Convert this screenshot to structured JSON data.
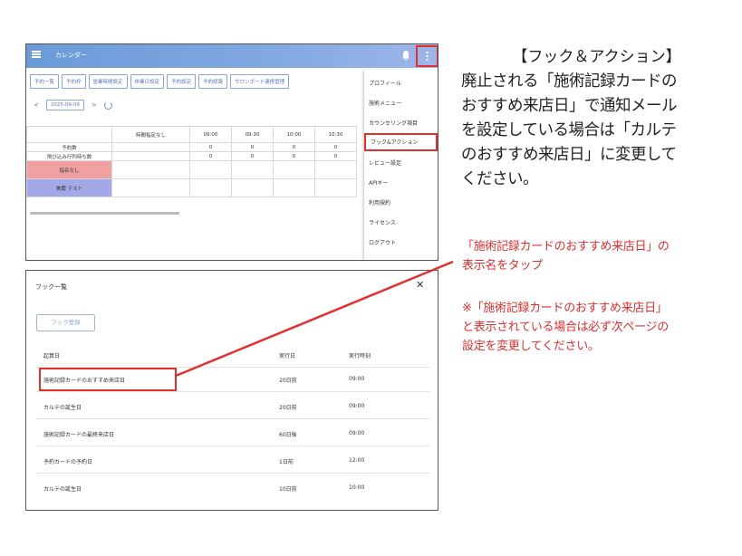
{
  "calendar": {
    "title": "カレンダー",
    "tabs": [
      "予約一覧",
      "予約枠",
      "営業時間設定",
      "休業日設定",
      "予約設定",
      "予約経路",
      "サロンボード連携管理"
    ],
    "date": "2025-09-09",
    "prev_glyph": "<",
    "next_glyph": ">",
    "header_cells": [
      "時間指定なし",
      "09:00",
      "09:30",
      "10:00",
      "10:30"
    ],
    "rows": [
      {
        "label": "予約数",
        "values": [
          "0",
          "0",
          "0",
          "0"
        ]
      },
      {
        "label": "飛び込み行列待ち数",
        "values": [
          "0",
          "0",
          "0",
          "0"
        ]
      }
    ],
    "staff": [
      {
        "name": "指名なし",
        "color": "#f0a0a0"
      },
      {
        "name": "美慶 テスト",
        "color": "#a3a8e6"
      }
    ],
    "menu_items": [
      "プロフィール",
      "施術メニュー",
      "カウンセリング項目",
      "フック&アクション",
      "レビュー設定",
      "APIキー",
      "利用規約",
      "ライセンス",
      "ログアウト"
    ],
    "active_menu_item": "フック&アクション"
  },
  "hooks": {
    "title": "フック一覧",
    "close_glyph": "✕",
    "register_button": "フック登録",
    "columns": [
      "起算日",
      "実行日",
      "実行時刻"
    ],
    "rows": [
      {
        "base": "施術記録カードのおすすめ来店日",
        "day": "20日前",
        "time": "09:00"
      },
      {
        "base": "カルテの誕生日",
        "day": "20日前",
        "time": "09:00"
      },
      {
        "base": "施術記録カードの最終来店日",
        "day": "60日後",
        "time": "09:00"
      },
      {
        "base": "予約カードの予約日",
        "day": "1日前",
        "time": "12:00"
      },
      {
        "base": "カルテの誕生日",
        "day": "10日前",
        "time": "10:00"
      }
    ]
  },
  "annotation": {
    "heading": "【フック＆アクション】",
    "body": "廃止される「施術記録カードの\nおすすめ来店日」で通知メール\nを設定している場合は「カルテ\nのおすすめ来店日」に変更して\nください。",
    "note_tap": "「施術記録カードのおすすめ来店日」の\n表示名をタップ",
    "note_warning": "※「施術記録カードのおすすめ来店日」\nと表示されている場合は必ず次ページの\n設定を変更してください。",
    "highlight_color": "#e23030"
  }
}
